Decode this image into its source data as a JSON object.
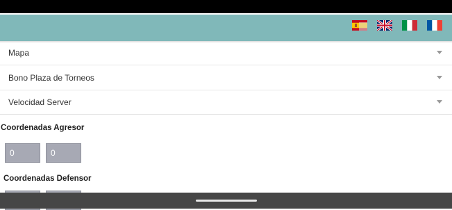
{
  "header": {
    "languages": [
      {
        "icon": "spain-flag-icon",
        "code": "es"
      },
      {
        "icon": "uk-flag-icon",
        "code": "en"
      },
      {
        "icon": "italy-flag-icon",
        "code": "it"
      },
      {
        "icon": "france-flag-icon",
        "code": "fr"
      }
    ],
    "colors": {
      "header": "#80b8b9",
      "input": "#a7a9b4"
    }
  },
  "dropdowns": [
    {
      "label": "Mapa"
    },
    {
      "label": "Bono Plaza de Torneos"
    },
    {
      "label": "Velocidad Server"
    }
  ],
  "attacker": {
    "title": "Coordenadas Agresor",
    "x_value": "0",
    "y_value": "0"
  },
  "defender": {
    "title": "Coordenadas Defensor"
  }
}
